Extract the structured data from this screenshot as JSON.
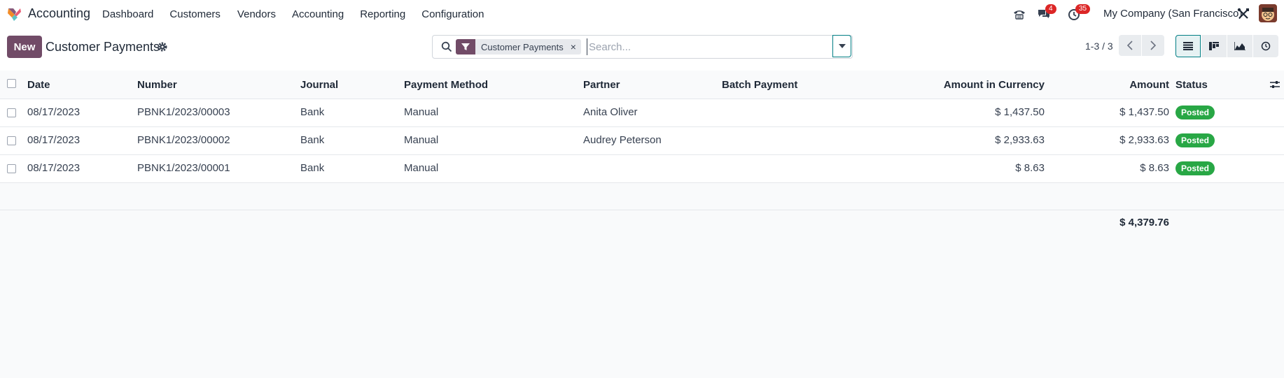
{
  "app": {
    "name": "Accounting",
    "menu": [
      "Dashboard",
      "Customers",
      "Vendors",
      "Accounting",
      "Reporting",
      "Configuration"
    ],
    "messages_count": "4",
    "activities_count": "35",
    "company": "My Company (San Francisco)"
  },
  "control": {
    "new_label": "New",
    "title": "Customer Payments",
    "facet_label": "Customer Payments",
    "facet_remove": "×",
    "search_placeholder": "Search...",
    "pager": "1-3 / 3"
  },
  "table": {
    "headers": {
      "date": "Date",
      "number": "Number",
      "journal": "Journal",
      "payment_method": "Payment Method",
      "partner": "Partner",
      "batch_payment": "Batch Payment",
      "amount_currency": "Amount in Currency",
      "amount": "Amount",
      "status": "Status"
    },
    "rows": [
      {
        "date": "08/17/2023",
        "number": "PBNK1/2023/00003",
        "journal": "Bank",
        "payment_method": "Manual",
        "partner": "Anita Oliver",
        "batch_payment": "",
        "amount_currency": "$ 1,437.50",
        "amount": "$ 1,437.50",
        "status": "Posted"
      },
      {
        "date": "08/17/2023",
        "number": "PBNK1/2023/00002",
        "journal": "Bank",
        "payment_method": "Manual",
        "partner": "Audrey Peterson",
        "batch_payment": "",
        "amount_currency": "$ 2,933.63",
        "amount": "$ 2,933.63",
        "status": "Posted"
      },
      {
        "date": "08/17/2023",
        "number": "PBNK1/2023/00001",
        "journal": "Bank",
        "payment_method": "Manual",
        "partner": "",
        "batch_payment": "",
        "amount_currency": "$ 8.63",
        "amount": "$ 8.63",
        "status": "Posted"
      }
    ],
    "total_amount": "$ 4,379.76"
  },
  "colors": {
    "brand": "#714b67",
    "accent": "#017e84",
    "posted": "#28a745",
    "badge": "#dc2626"
  }
}
